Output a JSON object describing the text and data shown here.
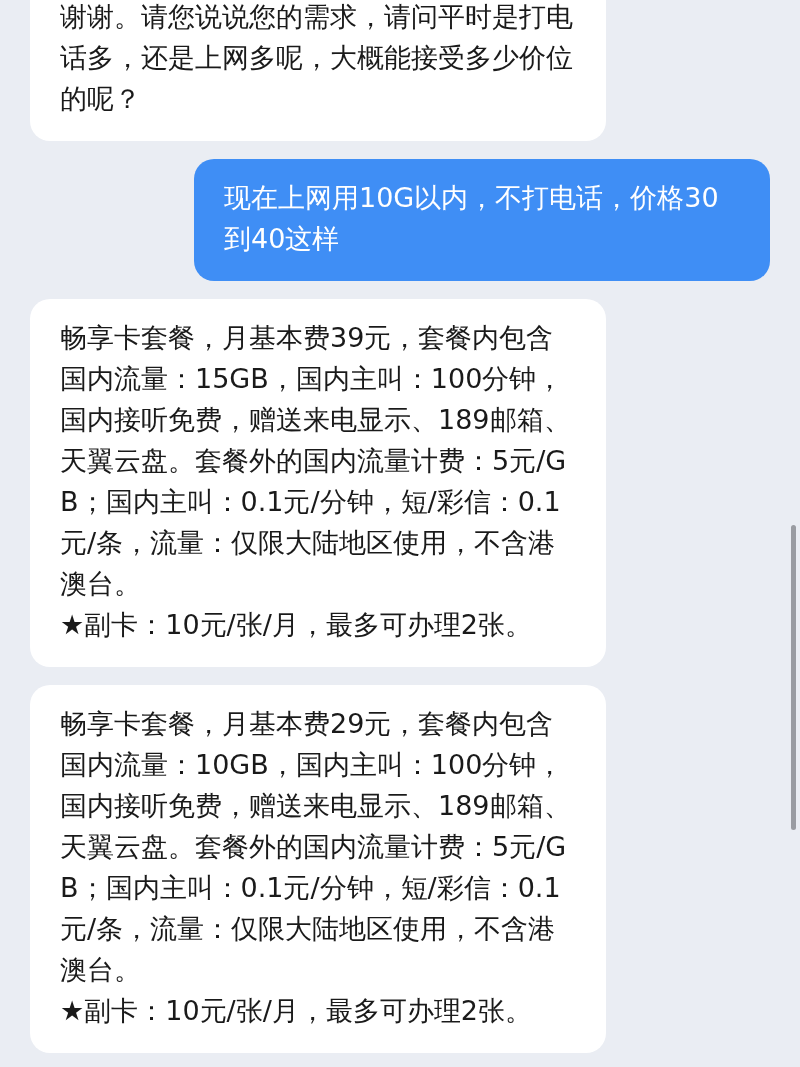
{
  "messages": [
    {
      "kind": "received",
      "text": "谢谢。请您说说您的需求，请问平时是打电话多，还是上网多呢，大概能接受多少价位的呢？"
    },
    {
      "kind": "sent",
      "text": "现在上网用10G以内，不打电话，价格30到40这样"
    },
    {
      "kind": "received",
      "text": "畅享卡套餐，月基本费39元，套餐内包含国内流量：15GB，国内主叫：100分钟，国内接听免费，赠送来电显示、189邮箱、天翼云盘。套餐外的国内流量计费：5元/GB；国内主叫：0.1元/分钟，短/彩信：0.1元/条，流量：仅限大陆地区使用，不含港澳台。\n★副卡：10元/张/月，最多可办理2张。"
    },
    {
      "kind": "received",
      "text": "畅享卡套餐，月基本费29元，套餐内包含国内流量：10GB，国内主叫：100分钟，国内接听免费，赠送来电显示、189邮箱、天翼云盘。套餐外的国内流量计费：5元/GB；国内主叫：0.1元/分钟，短/彩信：0.1元/条，流量：仅限大陆地区使用，不含港澳台。\n★副卡：10元/张/月，最多可办理2张。"
    }
  ]
}
